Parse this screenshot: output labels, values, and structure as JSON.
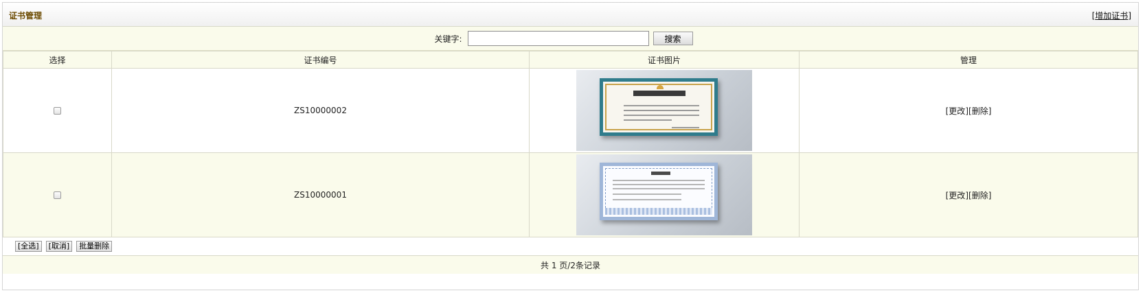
{
  "header": {
    "title": "证书管理",
    "add_link": "增加证书"
  },
  "search": {
    "label": "关键字:",
    "value": "",
    "placeholder": "",
    "button": "搜索"
  },
  "table": {
    "columns": [
      "选择",
      "证书编号",
      "证书图片",
      "管理"
    ],
    "rows": [
      {
        "number": "ZS10000002",
        "image": "honor-certificate-thumbnail",
        "edit": "更改",
        "delete": "删除",
        "checked": false
      },
      {
        "number": "ZS10000001",
        "image": "authorization-certificate-thumbnail",
        "edit": "更改",
        "delete": "删除",
        "checked": false
      }
    ]
  },
  "bulk": {
    "select_all": "[全选]",
    "cancel": "[取消]",
    "batch_delete": "批量删除"
  },
  "pagination": {
    "text": "共 1 页/2条记录"
  }
}
